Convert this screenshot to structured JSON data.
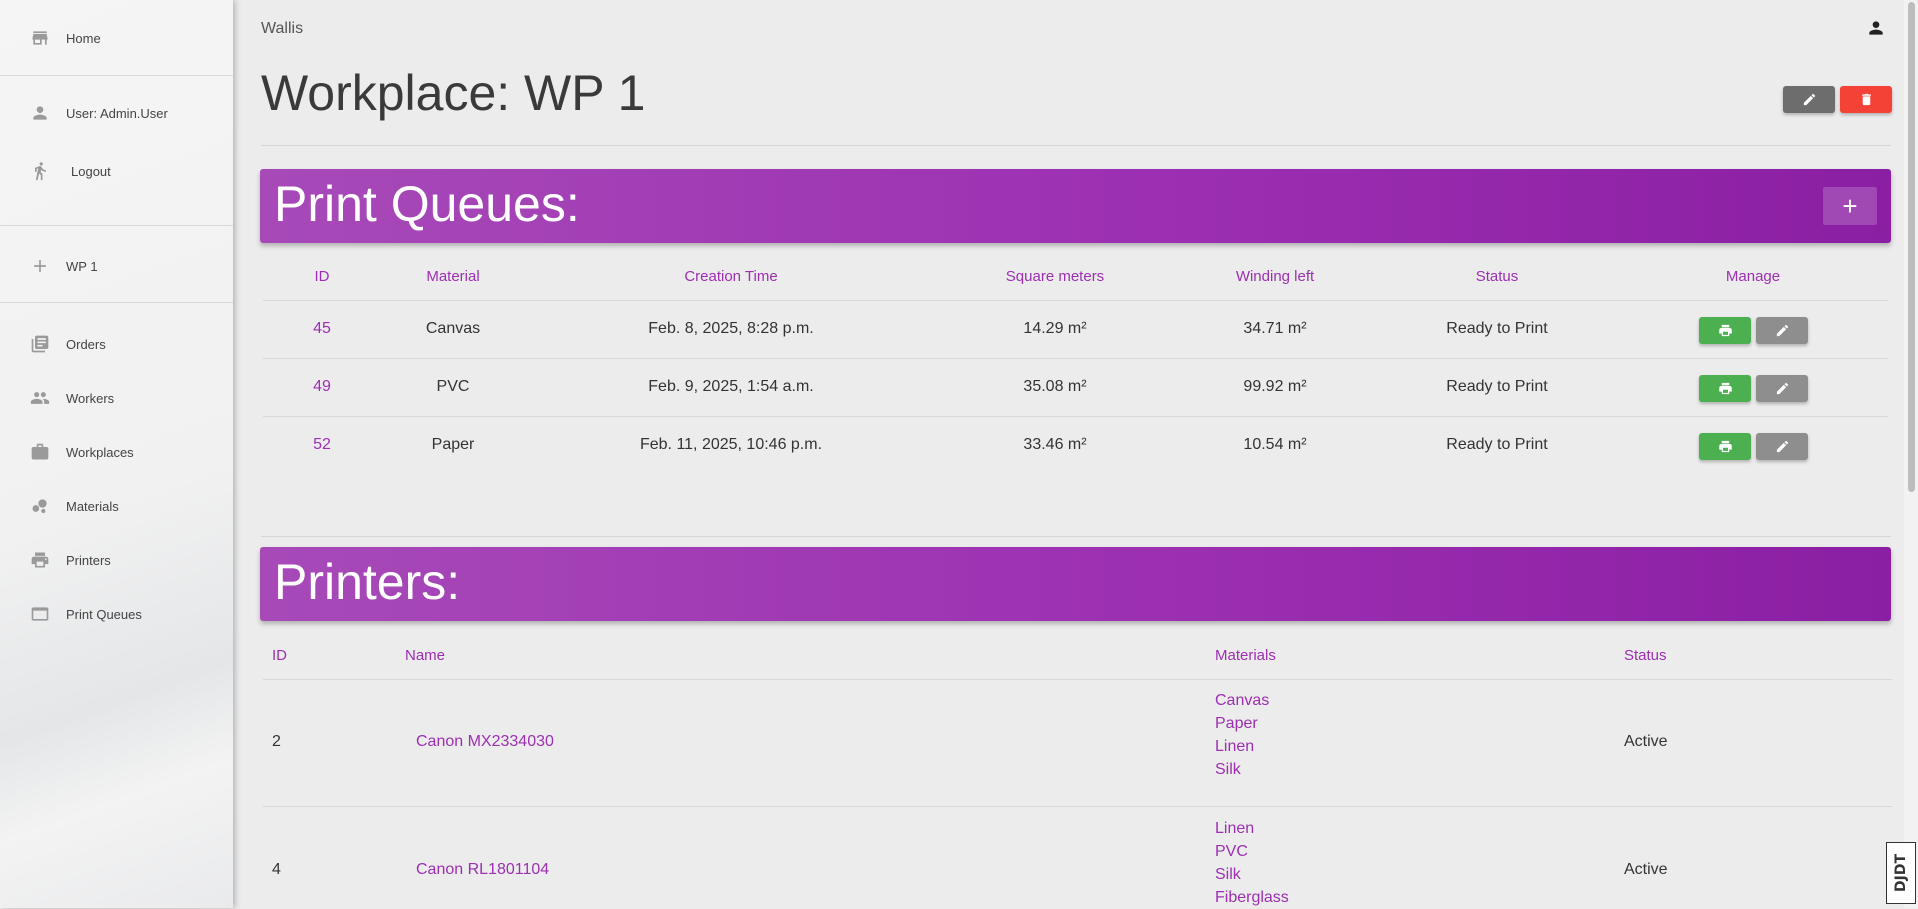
{
  "sidebar": {
    "items": [
      {
        "label": "Home",
        "icon": "store-icon"
      },
      {
        "label": "User: Admin.User",
        "icon": "person-icon"
      },
      {
        "label": "Logout",
        "icon": "run-icon"
      },
      {
        "label": "WP 1",
        "icon": "plus-icon"
      },
      {
        "label": "Orders",
        "icon": "library-books-icon"
      },
      {
        "label": "Workers",
        "icon": "people-icon"
      },
      {
        "label": "Workplaces",
        "icon": "work-icon"
      },
      {
        "label": "Materials",
        "icon": "bubbles-icon"
      },
      {
        "label": "Printers",
        "icon": "print-icon"
      },
      {
        "label": "Print Queues",
        "icon": "folder-icon"
      }
    ]
  },
  "header": {
    "brand": "Wallis",
    "page_title": "Workplace: WP 1"
  },
  "print_queues": {
    "title": "Print Queues:",
    "add_label": "+",
    "columns": [
      "ID",
      "Material",
      "Creation Time",
      "Square meters",
      "Winding left",
      "Status",
      "Manage"
    ],
    "rows": [
      {
        "id": "45",
        "material": "Canvas",
        "created": "Feb. 8, 2025, 8:28 p.m.",
        "sqm": "14.29 m²",
        "winding": "34.71 m²",
        "status": "Ready to Print"
      },
      {
        "id": "49",
        "material": "PVC",
        "created": "Feb. 9, 2025, 1:54 a.m.",
        "sqm": "35.08 m²",
        "winding": "99.92 m²",
        "status": "Ready to Print"
      },
      {
        "id": "52",
        "material": "Paper",
        "created": "Feb. 11, 2025, 10:46 p.m.",
        "sqm": "33.46 m²",
        "winding": "10.54 m²",
        "status": "Ready to Print"
      }
    ]
  },
  "printers": {
    "title": "Printers:",
    "columns": [
      "ID",
      "Name",
      "Materials",
      "Status"
    ],
    "rows": [
      {
        "id": "2",
        "name": "Canon MX2334030",
        "materials": [
          "Canvas",
          "Paper",
          "Linen",
          "Silk"
        ],
        "status": "Active"
      },
      {
        "id": "4",
        "name": "Canon RL1801104",
        "materials": [
          "Linen",
          "PVC",
          "Silk",
          "Fiberglass"
        ],
        "status": "Active"
      }
    ]
  },
  "debug_toolbar": {
    "label": "DJDT"
  },
  "colors": {
    "accent": "#9c2fb2",
    "danger": "#f44336",
    "success": "#4caf50"
  }
}
